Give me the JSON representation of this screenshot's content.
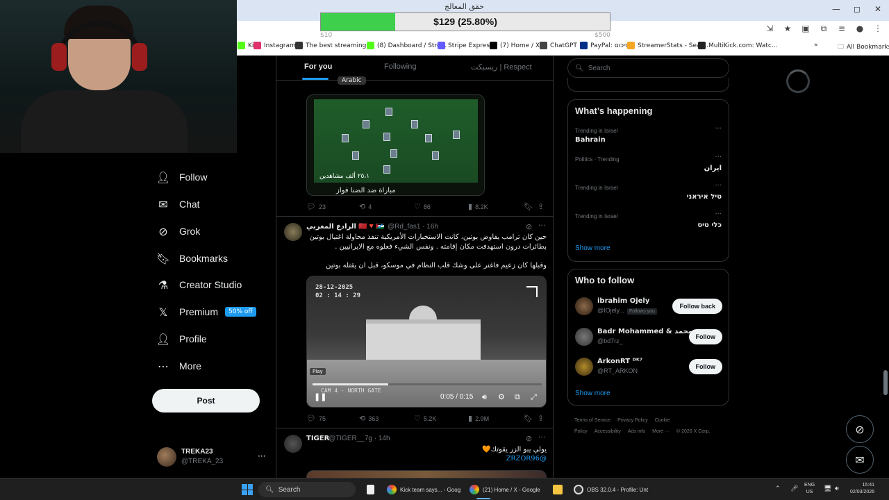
{
  "browser": {
    "titlebar_text": "حقق المعالج",
    "window_controls": {
      "minimize": "—",
      "maximize": "◻",
      "close": "✕"
    },
    "bookmarks": [
      {
        "label": "Kick",
        "color": "#53fc18"
      },
      {
        "label": "Instagram",
        "color": "#e1306c"
      },
      {
        "label": "The best streaming...",
        "color": "#333333"
      },
      {
        "label": "(8) Dashboard / Stre...",
        "color": "#53fc18"
      },
      {
        "label": "Stripe Express",
        "color": "#635bff"
      },
      {
        "label": "(7) Home / X",
        "color": "#000000"
      },
      {
        "label": "ChatGPT",
        "color": "#444444"
      },
      {
        "label": "PayPal: סיכום",
        "color": "#003087"
      },
      {
        "label": "StreamerStats - Sear...",
        "color": "#f5a623"
      },
      {
        "label": "MultiKick.com: Watc...",
        "color": "#222222"
      }
    ],
    "all_bookmarks": "All Bookmarks"
  },
  "donation": {
    "label": "$129 (25.80%)",
    "progress_percent": 25.8,
    "min_label": "$10",
    "max_label": "$500"
  },
  "nav": {
    "items": [
      {
        "label": "Follow",
        "icon": "person-plus-icon"
      },
      {
        "label": "Chat",
        "icon": "mail-icon"
      },
      {
        "label": "Grok",
        "icon": "grok-icon"
      },
      {
        "label": "Bookmarks",
        "icon": "bookmark-icon"
      },
      {
        "label": "Creator Studio",
        "icon": "creator-icon"
      },
      {
        "label": "Premium",
        "icon": "x-logo-icon",
        "badge": "50% off"
      },
      {
        "label": "Profile",
        "icon": "person-icon"
      },
      {
        "label": "More",
        "icon": "more-circle-icon"
      }
    ],
    "post_button": "Post",
    "account": {
      "name": "TREKA23",
      "handle": "@TREKA_23"
    }
  },
  "feed": {
    "tabs": [
      "For you",
      "Following",
      "ريسبكت | Respect"
    ],
    "tweet1": {
      "media_tag": "Arabic",
      "overlay_text": "٢٥،١ ألف مشاهدين",
      "caption": "مباراة ضد الضنا فواز",
      "stats": {
        "replies": "23",
        "reposts": "4",
        "likes": "86",
        "views": "8.2K"
      }
    },
    "tweet2": {
      "name": "الرادع المغربي 🇲🇦🔻🇵🇸",
      "meta": "@Rd_fas1 · 16h",
      "text_line1": "حين كان ترامب يفاوض بوتين، كانت الاستخبارات الأمريكية تنفذ محاولة اغتيال بوتين",
      "text_line2": "بطائرات درون استهدفت مكان إقامته . ونفس الشيء فعلوه مع الايرانيين .",
      "text_line3": "وقبلها كان زعيم فاغنر على وشك قلب النظام في موسكو، قبل ان يقتله بوتين",
      "video": {
        "date": "28-12-2025",
        "clock": "02 : 14 : 29",
        "cam_label": "CAM 4 - NORTH GATE",
        "play_tag": "Play",
        "time": "0:05 / 0:15",
        "progress_percent": 33
      },
      "stats": {
        "replies": "75",
        "reposts": "363",
        "likes": "5.2K",
        "views": "2.9M"
      }
    },
    "tweet3": {
      "name": "TIGER",
      "meta": "@TIGER__7g · 14h",
      "text": "يولي يبو الزر يقوتك🧡",
      "mention": "@ZRZOR96"
    }
  },
  "right": {
    "search_placeholder": "Search",
    "whats_happening": {
      "title": "What’s happening",
      "trends": [
        {
          "category": "Trending in Israel",
          "name": "Bahrain"
        },
        {
          "category": "Politics · Trending",
          "name": "ايران"
        },
        {
          "category": "Trending in Israel",
          "name": "טיל איראני"
        },
        {
          "category": "Trending in Israel",
          "name": "כלי טיס"
        }
      ],
      "show_more": "Show more"
    },
    "who_to_follow": {
      "title": "Who to follow",
      "accounts": [
        {
          "name": "ibrahim Ojely",
          "handle": "@IOjely...",
          "follows_you": "Follows you",
          "button": "Follow back"
        },
        {
          "name": "Badr Mohammed & محمد...",
          "handle": "@bd7rz_",
          "follows_you": "",
          "button": "Follow"
        },
        {
          "name": "ArkonRT ᴰᴷ⁷",
          "handle": "@RT_ARKON",
          "follows_you": "",
          "button": "Follow"
        }
      ],
      "show_more": "Show more"
    },
    "footer": {
      "links": [
        "Terms of Service",
        "Privacy Policy",
        "Cookie Policy",
        "Accessibility",
        "Ads info",
        "More ···",
        "© 2026 X Corp."
      ]
    }
  },
  "taskbar": {
    "search": "Search",
    "apps": [
      {
        "label": "Kick team says... - Goog"
      },
      {
        "label": "(21) Home / X - Google"
      },
      {
        "label": "OBS 32.0.4 - Profile: Unt"
      }
    ],
    "lang_top": "ENG",
    "lang_bottom": "US",
    "time": "15:41",
    "date": "02/03/2026"
  },
  "colors": {
    "accent": "#1d9bf0",
    "background": "#000000",
    "donation_fill": "#3ecf4c"
  }
}
